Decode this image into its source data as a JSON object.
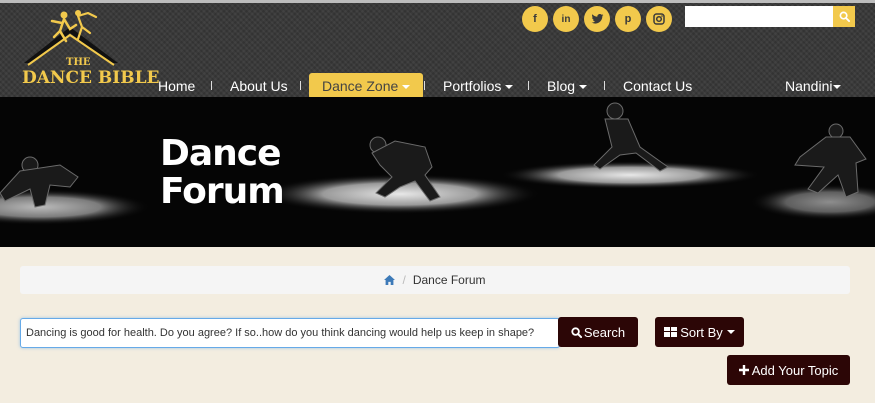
{
  "logo": {
    "line1": "THE",
    "line2": "DANCE BIBLE"
  },
  "socials": [
    {
      "icon": "facebook-icon",
      "glyph": "f"
    },
    {
      "icon": "linkedin-icon",
      "glyph": "in"
    },
    {
      "icon": "twitter-icon",
      "glyph": "🐦"
    },
    {
      "icon": "pinterest-icon",
      "glyph": "p"
    },
    {
      "icon": "instagram-icon",
      "glyph": "◙"
    }
  ],
  "top_search": {
    "placeholder": "",
    "value": ""
  },
  "nav": {
    "items": [
      {
        "label": "Home"
      },
      {
        "label": "About Us"
      },
      {
        "label": "Dance Zone"
      },
      {
        "label": "Portfolios"
      },
      {
        "label": "Blog"
      },
      {
        "label": "Contact Us"
      }
    ],
    "user": "Nandini"
  },
  "banner": {
    "title": "Dance Forum"
  },
  "breadcrumb": {
    "current": "Dance Forum"
  },
  "forum": {
    "search_value": "Dancing is good for health. Do you agree? If so..how do you think dancing would help us keep in shape?",
    "search_button": "Search",
    "sort_button": "Sort By",
    "add_button": "Add Your Topic"
  },
  "colors": {
    "accent": "#f2c94c",
    "dark_button": "#2c0606",
    "page_bg": "#f3ede0",
    "header_bg": "#3a3a3a"
  }
}
